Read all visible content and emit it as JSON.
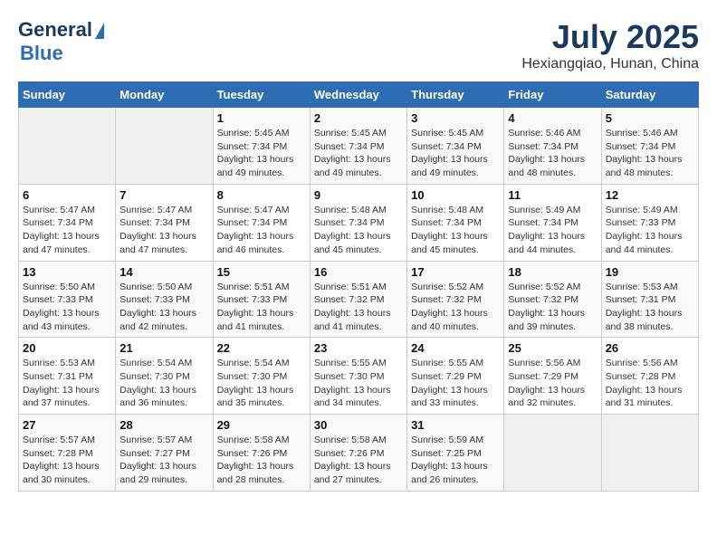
{
  "header": {
    "logo_line1": "General",
    "logo_line2": "Blue",
    "month_year": "July 2025",
    "location": "Hexiangqiao, Hunan, China"
  },
  "days_of_week": [
    "Sunday",
    "Monday",
    "Tuesday",
    "Wednesday",
    "Thursday",
    "Friday",
    "Saturday"
  ],
  "weeks": [
    [
      {
        "day": "",
        "info": ""
      },
      {
        "day": "",
        "info": ""
      },
      {
        "day": "1",
        "info": "Sunrise: 5:45 AM\nSunset: 7:34 PM\nDaylight: 13 hours and 49 minutes."
      },
      {
        "day": "2",
        "info": "Sunrise: 5:45 AM\nSunset: 7:34 PM\nDaylight: 13 hours and 49 minutes."
      },
      {
        "day": "3",
        "info": "Sunrise: 5:45 AM\nSunset: 7:34 PM\nDaylight: 13 hours and 49 minutes."
      },
      {
        "day": "4",
        "info": "Sunrise: 5:46 AM\nSunset: 7:34 PM\nDaylight: 13 hours and 48 minutes."
      },
      {
        "day": "5",
        "info": "Sunrise: 5:46 AM\nSunset: 7:34 PM\nDaylight: 13 hours and 48 minutes."
      }
    ],
    [
      {
        "day": "6",
        "info": "Sunrise: 5:47 AM\nSunset: 7:34 PM\nDaylight: 13 hours and 47 minutes."
      },
      {
        "day": "7",
        "info": "Sunrise: 5:47 AM\nSunset: 7:34 PM\nDaylight: 13 hours and 47 minutes."
      },
      {
        "day": "8",
        "info": "Sunrise: 5:47 AM\nSunset: 7:34 PM\nDaylight: 13 hours and 46 minutes."
      },
      {
        "day": "9",
        "info": "Sunrise: 5:48 AM\nSunset: 7:34 PM\nDaylight: 13 hours and 45 minutes."
      },
      {
        "day": "10",
        "info": "Sunrise: 5:48 AM\nSunset: 7:34 PM\nDaylight: 13 hours and 45 minutes."
      },
      {
        "day": "11",
        "info": "Sunrise: 5:49 AM\nSunset: 7:34 PM\nDaylight: 13 hours and 44 minutes."
      },
      {
        "day": "12",
        "info": "Sunrise: 5:49 AM\nSunset: 7:33 PM\nDaylight: 13 hours and 44 minutes."
      }
    ],
    [
      {
        "day": "13",
        "info": "Sunrise: 5:50 AM\nSunset: 7:33 PM\nDaylight: 13 hours and 43 minutes."
      },
      {
        "day": "14",
        "info": "Sunrise: 5:50 AM\nSunset: 7:33 PM\nDaylight: 13 hours and 42 minutes."
      },
      {
        "day": "15",
        "info": "Sunrise: 5:51 AM\nSunset: 7:33 PM\nDaylight: 13 hours and 41 minutes."
      },
      {
        "day": "16",
        "info": "Sunrise: 5:51 AM\nSunset: 7:32 PM\nDaylight: 13 hours and 41 minutes."
      },
      {
        "day": "17",
        "info": "Sunrise: 5:52 AM\nSunset: 7:32 PM\nDaylight: 13 hours and 40 minutes."
      },
      {
        "day": "18",
        "info": "Sunrise: 5:52 AM\nSunset: 7:32 PM\nDaylight: 13 hours and 39 minutes."
      },
      {
        "day": "19",
        "info": "Sunrise: 5:53 AM\nSunset: 7:31 PM\nDaylight: 13 hours and 38 minutes."
      }
    ],
    [
      {
        "day": "20",
        "info": "Sunrise: 5:53 AM\nSunset: 7:31 PM\nDaylight: 13 hours and 37 minutes."
      },
      {
        "day": "21",
        "info": "Sunrise: 5:54 AM\nSunset: 7:30 PM\nDaylight: 13 hours and 36 minutes."
      },
      {
        "day": "22",
        "info": "Sunrise: 5:54 AM\nSunset: 7:30 PM\nDaylight: 13 hours and 35 minutes."
      },
      {
        "day": "23",
        "info": "Sunrise: 5:55 AM\nSunset: 7:30 PM\nDaylight: 13 hours and 34 minutes."
      },
      {
        "day": "24",
        "info": "Sunrise: 5:55 AM\nSunset: 7:29 PM\nDaylight: 13 hours and 33 minutes."
      },
      {
        "day": "25",
        "info": "Sunrise: 5:56 AM\nSunset: 7:29 PM\nDaylight: 13 hours and 32 minutes."
      },
      {
        "day": "26",
        "info": "Sunrise: 5:56 AM\nSunset: 7:28 PM\nDaylight: 13 hours and 31 minutes."
      }
    ],
    [
      {
        "day": "27",
        "info": "Sunrise: 5:57 AM\nSunset: 7:28 PM\nDaylight: 13 hours and 30 minutes."
      },
      {
        "day": "28",
        "info": "Sunrise: 5:57 AM\nSunset: 7:27 PM\nDaylight: 13 hours and 29 minutes."
      },
      {
        "day": "29",
        "info": "Sunrise: 5:58 AM\nSunset: 7:26 PM\nDaylight: 13 hours and 28 minutes."
      },
      {
        "day": "30",
        "info": "Sunrise: 5:58 AM\nSunset: 7:26 PM\nDaylight: 13 hours and 27 minutes."
      },
      {
        "day": "31",
        "info": "Sunrise: 5:59 AM\nSunset: 7:25 PM\nDaylight: 13 hours and 26 minutes."
      },
      {
        "day": "",
        "info": ""
      },
      {
        "day": "",
        "info": ""
      }
    ]
  ]
}
